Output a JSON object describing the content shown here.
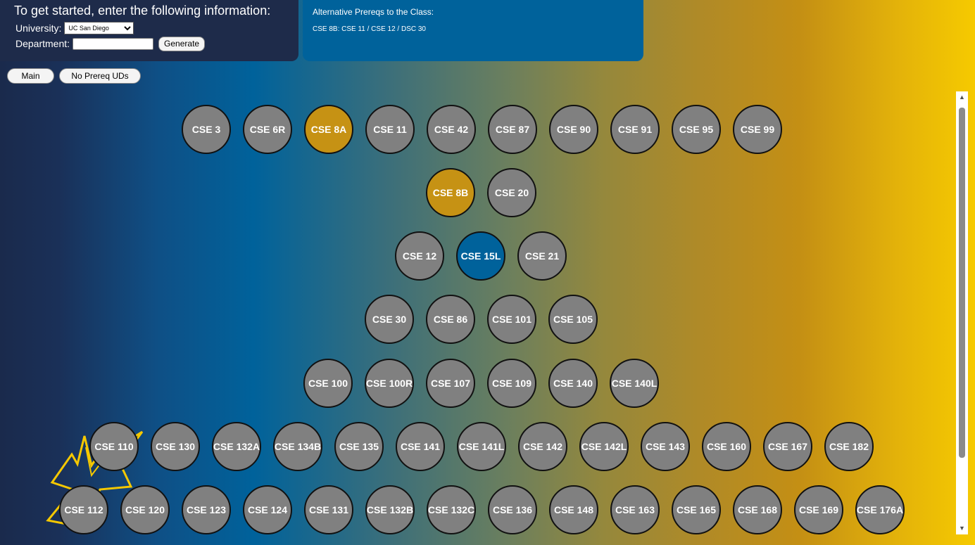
{
  "form": {
    "title": "To get started, enter the following information:",
    "university_label": "University:",
    "university_value": "UC San Diego",
    "department_label": "Department:",
    "department_value": "",
    "generate_label": "Generate"
  },
  "alt_prereqs": {
    "title": "Alternative Prereqs to the Class:",
    "line": "CSE 8B: CSE 11 / CSE 12 / DSC 30"
  },
  "tabs": [
    "Main",
    "No Prereq UDs"
  ],
  "rows": [
    [
      "CSE 3",
      "CSE 6R",
      "CSE 8A",
      "CSE 11",
      "CSE 42",
      "CSE 87",
      "CSE 90",
      "CSE 91",
      "CSE 95",
      "CSE 99"
    ],
    [
      "CSE 8B",
      "CSE 20"
    ],
    [
      "CSE 12",
      "CSE 15L",
      "CSE 21"
    ],
    [
      "CSE 30",
      "CSE 86",
      "CSE 101",
      "CSE 105"
    ],
    [
      "CSE 100",
      "CSE 100R",
      "CSE 107",
      "CSE 109",
      "CSE 140",
      "CSE 140L"
    ],
    [
      "CSE 110",
      "CSE 130",
      "CSE 132A",
      "CSE 134B",
      "CSE 135",
      "CSE 141",
      "CSE 141L",
      "CSE 142",
      "CSE 142L",
      "CSE 143",
      "CSE 160",
      "CSE 167",
      "CSE 182"
    ],
    [
      "CSE 112",
      "CSE 120",
      "CSE 123",
      "CSE 124",
      "CSE 131",
      "CSE 132B",
      "CSE 132C",
      "CSE 136",
      "CSE 148",
      "CSE 163",
      "CSE 165",
      "CSE 168",
      "CSE 169",
      "CSE 176A"
    ]
  ],
  "highlight": {
    "selected": [
      "CSE 8A",
      "CSE 8B"
    ],
    "selected_color": "#c69214",
    "lab": [
      "CSE 15L"
    ],
    "lab_color": "#00629b",
    "default_color": "#808080"
  }
}
